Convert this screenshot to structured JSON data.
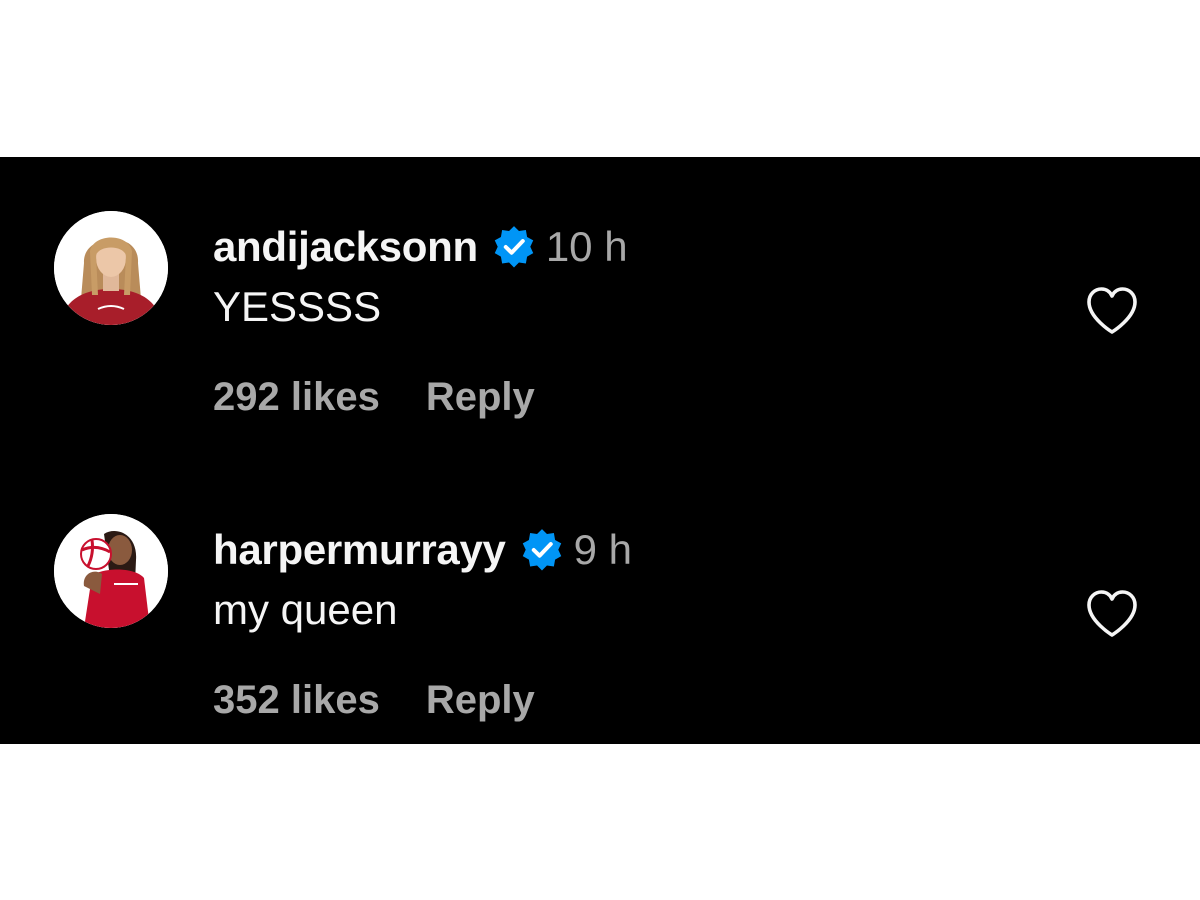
{
  "colors": {
    "background": "#000000",
    "primary_text": "#f5f5f5",
    "secondary_text": "#a8a8a8",
    "verified_badge": "#0095f6",
    "page_border": "#ffffff"
  },
  "comments": [
    {
      "username": "andijacksonn",
      "verified": true,
      "verified_icon": "verified-badge-icon",
      "time": "10 h",
      "text": "YESSSS",
      "likes": "292 likes",
      "reply_label": "Reply",
      "like_icon": "heart-outline-icon",
      "avatar_icon": "profile-photo"
    },
    {
      "username": "harpermurrayy",
      "verified": true,
      "verified_icon": "verified-badge-icon",
      "time": "9 h",
      "text": "my queen",
      "likes": "352 likes",
      "reply_label": "Reply",
      "like_icon": "heart-outline-icon",
      "avatar_icon": "profile-photo"
    }
  ]
}
